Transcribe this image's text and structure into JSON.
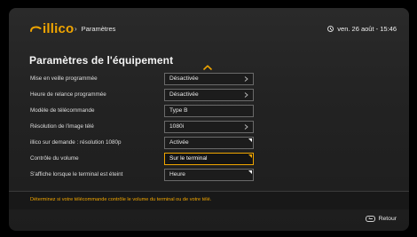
{
  "header": {
    "brand": "illico",
    "breadcrumb_separator": "›",
    "breadcrumb": "Paramètres",
    "datetime": "ven. 26 août - 15:46"
  },
  "main": {
    "title": "Paramètres de l'équipement",
    "rows": [
      {
        "label": "Mise en veille programmée",
        "value": "Désactivée",
        "control": "chevron"
      },
      {
        "label": "Heure de relance programmée",
        "value": "Désactivée",
        "control": "chevron"
      },
      {
        "label": "Modèle de télécommande",
        "value": "Type B",
        "control": "none"
      },
      {
        "label": "Résolution de l'image télé",
        "value": "1080i",
        "control": "chevron"
      },
      {
        "label": "illico sur demande : résolution 1080p",
        "value": "Activée",
        "control": "corner"
      },
      {
        "label": "Contrôle du volume",
        "value": "Sur le terminal",
        "control": "corner",
        "selected": true
      },
      {
        "label": "S'affiche lorsque le terminal est éteint",
        "value": "Heure",
        "control": "corner"
      }
    ]
  },
  "footer": {
    "help": "Déterminez si votre télécommande contrôle le volume du terminal ou de votre télé.",
    "back_label": "Retour"
  },
  "colors": {
    "accent": "#f0a500",
    "background": "#232323"
  },
  "icons": {
    "logo": "illico-logo-icon",
    "clock": "clock-icon",
    "scroll_up": "chevron-up-icon",
    "chevron": "chevron-right-icon",
    "corner": "corner-tab-icon",
    "back": "back-button-icon"
  }
}
